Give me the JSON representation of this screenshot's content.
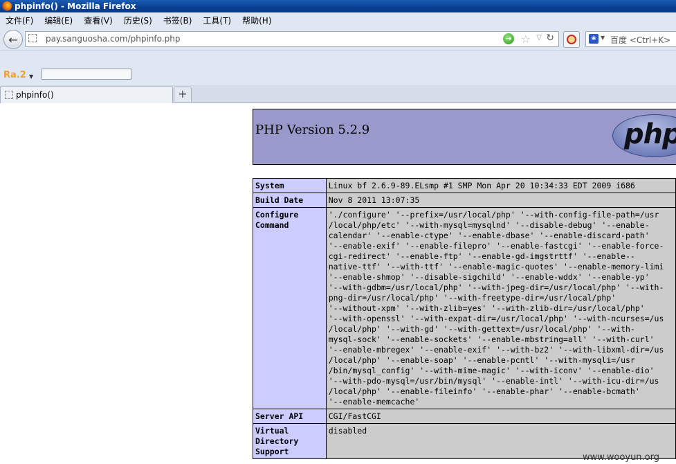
{
  "window": {
    "title": "phpinfo() - Mozilla Firefox"
  },
  "menu": [
    {
      "label": "文件(F)"
    },
    {
      "label": "编辑(E)"
    },
    {
      "label": "查看(V)"
    },
    {
      "label": "历史(S)"
    },
    {
      "label": "书签(B)"
    },
    {
      "label": "工具(T)"
    },
    {
      "label": "帮助(H)"
    }
  ],
  "nav": {
    "url": "pay.sanguosha.com/phpinfo.php",
    "go_icon": "arrow-right-icon",
    "search_placeholder": "百度 <Ctrl+K>"
  },
  "addon": {
    "logo": "Ra.2"
  },
  "tabs": [
    {
      "label": "phpinfo()"
    }
  ],
  "page": {
    "version_title": "PHP Version 5.2.9",
    "logo_text": "php",
    "rows": [
      {
        "key": "System",
        "value": "Linux bf 2.6.9-89.ELsmp #1 SMP Mon Apr 20 10:34:33 EDT 2009 i686"
      },
      {
        "key": "Build Date",
        "value": "Nov 8 2011 13:07:35"
      },
      {
        "key": "Configure Command",
        "value": "'./configure' '--prefix=/usr/local/php' '--with-config-file-path=/usr\n/local/php/etc' '--with-mysql=mysqlnd' '--disable-debug' '--enable-\ncalendar' '--enable-ctype' '--enable-dbase' '--enable-discard-path'\n'--enable-exif' '--enable-filepro' '--enable-fastcgi' '--enable-force-\ncgi-redirect' '--enable-ftp' '--enable-gd-imgstrttf' '--enable--\nnative-ttf' '--with-ttf' '--enable-magic-quotes' '--enable-memory-limi\n'--enable-shmop' '--disable-sigchild' '--enable-wddx' '--enable-yp'\n'--with-gdbm=/usr/local/php' '--with-jpeg-dir=/usr/local/php' '--with-\npng-dir=/usr/local/php' '--with-freetype-dir=/usr/local/php'\n'--without-xpm' '--with-zlib=yes' '--with-zlib-dir=/usr/local/php'\n'--with-openssl' '--with-expat-dir=/usr/local/php' '--with-ncurses=/us\n/local/php' '--with-gd' '--with-gettext=/usr/local/php' '--with-\nmysql-sock' '--enable-sockets' '--enable-mbstring=all' '--with-curl'\n'--enable-mbregex' '--enable-exif' '--with-bz2' '--with-libxml-dir=/us\n/local/php' '--enable-soap' '--enable-pcntl' '--with-mysqli=/usr\n/bin/mysql_config' '--with-mime-magic' '--with-iconv' '--enable-dio'\n'--with-pdo-mysql=/usr/bin/mysql' '--enable-intl' '--with-icu-dir=/us\n/local/php' '--enable-fileinfo' '--enable-phar' '--enable-bcmath'\n'--enable-memcache'"
      },
      {
        "key": "Server API",
        "value": "CGI/FastCGI"
      },
      {
        "key": "Virtual Directory Support",
        "value": "disabled"
      }
    ]
  },
  "watermark": "www.wooyun.org"
}
